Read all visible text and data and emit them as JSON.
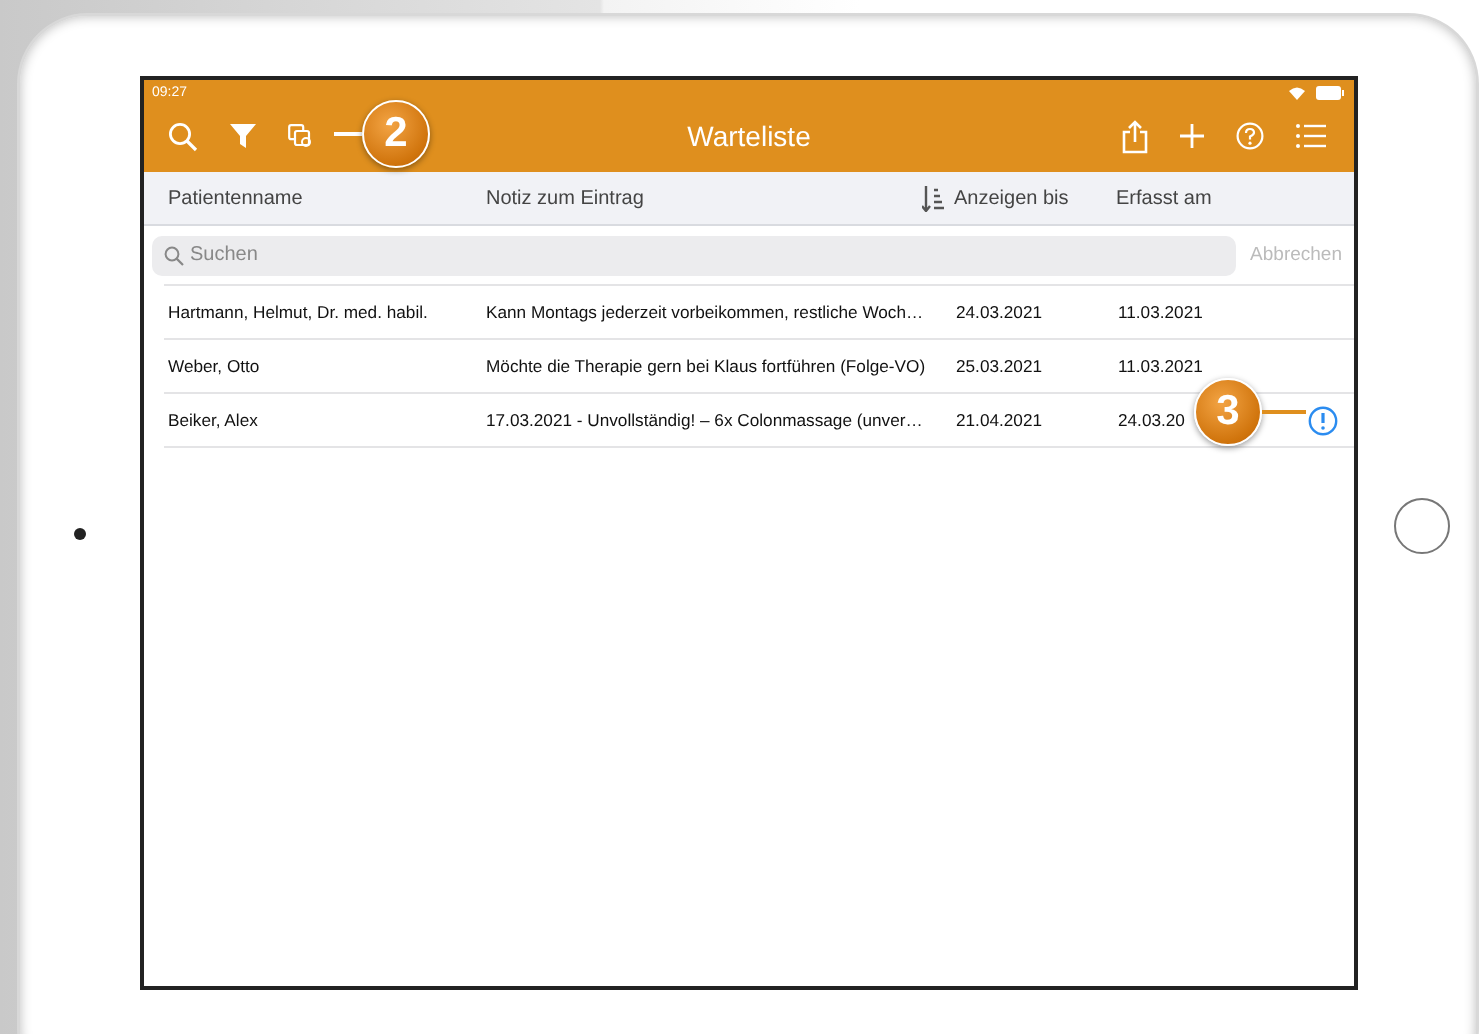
{
  "status_bar": {
    "time": "09:27"
  },
  "nav": {
    "title": "Warteliste"
  },
  "columns": [
    {
      "label": "Patientenname",
      "sorted": false
    },
    {
      "label": "Notiz zum Eintrag",
      "sorted": false
    },
    {
      "label": "Anzeigen bis",
      "sorted": true
    },
    {
      "label": "Erfasst am",
      "sorted": false
    }
  ],
  "search": {
    "placeholder": "Suchen",
    "cancel": "Abbrechen"
  },
  "rows": [
    {
      "name": "Hartmann, Helmut, Dr. med. habil.",
      "note": "Kann Montags jederzeit vorbeikommen, restliche Woch…",
      "until": "24.03.2021",
      "recorded": "11.03.2021",
      "warning": false
    },
    {
      "name": "Weber, Otto",
      "note": "Möchte die Therapie gern bei Klaus fortführen (Folge-VO)",
      "until": "25.03.2021",
      "recorded": "11.03.2021",
      "warning": false
    },
    {
      "name": "Beiker, Alex",
      "note": "17.03.2021 - Unvollständig! – 6x Colonmassage (unver…",
      "until": "21.04.2021",
      "recorded": "24.03.20",
      "warning": true
    }
  ],
  "callouts": [
    {
      "label": "2"
    },
    {
      "label": "3"
    }
  ]
}
